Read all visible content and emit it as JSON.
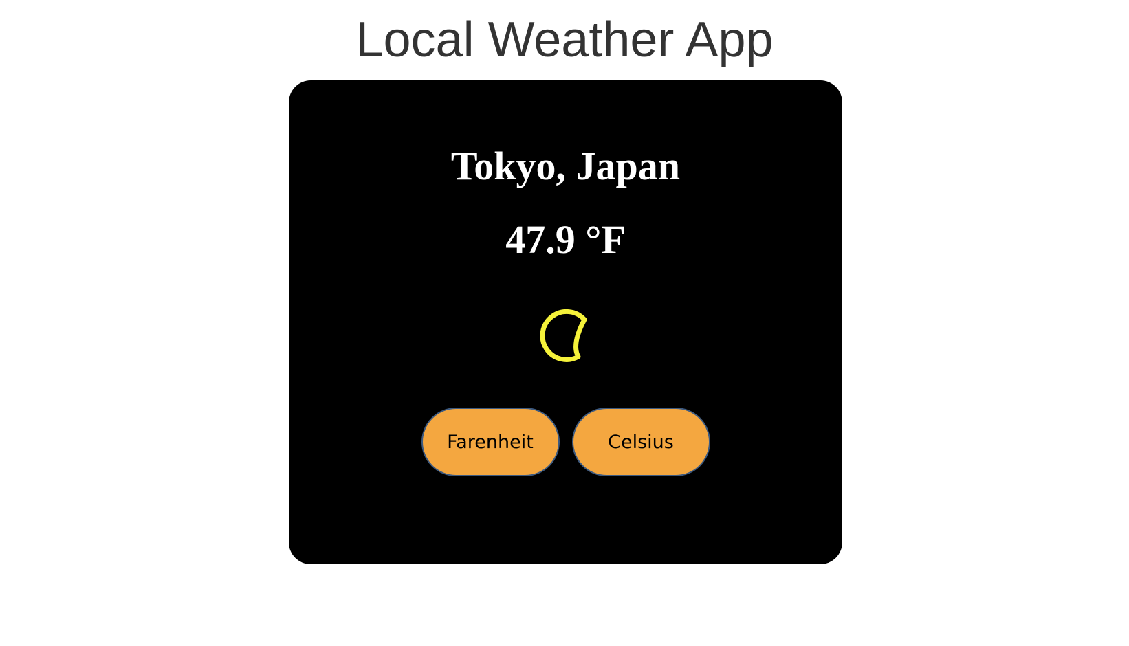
{
  "header": {
    "title": "Local Weather App"
  },
  "weather": {
    "location": "Tokyo, Japan",
    "temperature": "47.9 °F",
    "icon": "crescent-moon-icon",
    "icon_color": "#f5f23a"
  },
  "units": {
    "fahrenheit_label": "Farenheit",
    "celsius_label": "Celsius"
  },
  "colors": {
    "card_background": "#000000",
    "button_background": "#f4a740",
    "button_border": "#3d5a80"
  }
}
